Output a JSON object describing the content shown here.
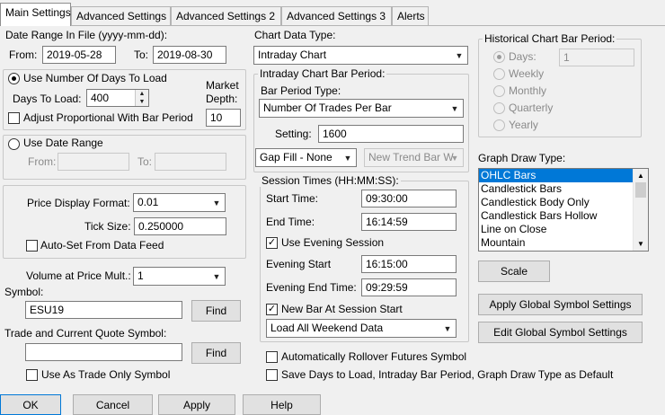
{
  "tabs": [
    "Main Settings",
    "Advanced Settings",
    "Advanced Settings 2",
    "Advanced Settings 3",
    "Alerts"
  ],
  "date_range": {
    "label": "Date Range In File (yyyy-mm-dd):",
    "from_label": "From:",
    "from_value": "2019-05-28",
    "to_label": "To:",
    "to_value": "2019-08-30"
  },
  "days_group": {
    "radio_label": "Use Number Of Days To Load",
    "days_label": "Days To Load:",
    "days_value": "400",
    "market_depth_label_1": "Market",
    "market_depth_label_2": "Depth:",
    "market_depth_value": "10",
    "adjust_label": "Adjust Proportional With Bar Period"
  },
  "date_range_group": {
    "radio_label": "Use Date Range",
    "from_label": "From:",
    "to_label": "To:"
  },
  "price_group": {
    "format_label": "Price Display Format:",
    "format_value": "0.01",
    "tick_label": "Tick Size:",
    "tick_value": "0.250000",
    "autoset_label": "Auto-Set From Data Feed"
  },
  "volume": {
    "label": "Volume at Price Mult.:",
    "value": "1"
  },
  "symbol": {
    "label": "Symbol:",
    "value": "ESU19",
    "find_label": "Find"
  },
  "trade_symbol": {
    "label": "Trade and Current Quote Symbol:",
    "value": "",
    "find_label": "Find",
    "use_label": "Use As Trade Only Symbol"
  },
  "chart_data_type": {
    "label": "Chart Data Type:",
    "value": "Intraday Chart"
  },
  "intraday_group": {
    "title": "Intraday Chart Bar Period:",
    "bar_type_label": "Bar Period Type:",
    "bar_type_value": "Number Of Trades Per Bar",
    "setting_label": "Setting:",
    "setting_value": "1600",
    "gap_fill_value": "Gap Fill - None",
    "new_trend_value": "New Trend Bar W"
  },
  "session_group": {
    "title": "Session Times (HH:MM:SS):",
    "start_label": "Start Time:",
    "start_value": "09:30:00",
    "end_label": "End Time:",
    "end_value": "16:14:59",
    "evening_label": "Use Evening Session",
    "evening_start_label": "Evening Start",
    "evening_start_value": "16:15:00",
    "evening_end_label": "Evening End Time:",
    "evening_end_value": "09:29:59",
    "new_bar_label": "New Bar At Session Start",
    "weekend_value": "Load All Weekend Data"
  },
  "rollover_label": "Automatically Rollover Futures Symbol",
  "save_default_label": "Save Days to Load, Intraday Bar Period, Graph Draw Type as Default",
  "historical_group": {
    "title": "Historical Chart Bar Period:",
    "days_label": "Days:",
    "days_value": "1",
    "options": [
      "Weekly",
      "Monthly",
      "Quarterly",
      "Yearly"
    ]
  },
  "graph_draw": {
    "label": "Graph Draw Type:",
    "items": [
      "OHLC Bars",
      "Candlestick Bars",
      "Candlestick Body Only",
      "Candlestick Bars Hollow",
      "Line on Close",
      "Mountain"
    ],
    "selected": "OHLC Bars"
  },
  "buttons": {
    "scale": "Scale",
    "apply_global": "Apply Global Symbol Settings",
    "edit_global": "Edit Global Symbol Settings",
    "ok": "OK",
    "cancel": "Cancel",
    "apply": "Apply",
    "help": "Help"
  },
  "glyphs": {
    "check": "✓",
    "down": "▼",
    "up": "▲"
  }
}
